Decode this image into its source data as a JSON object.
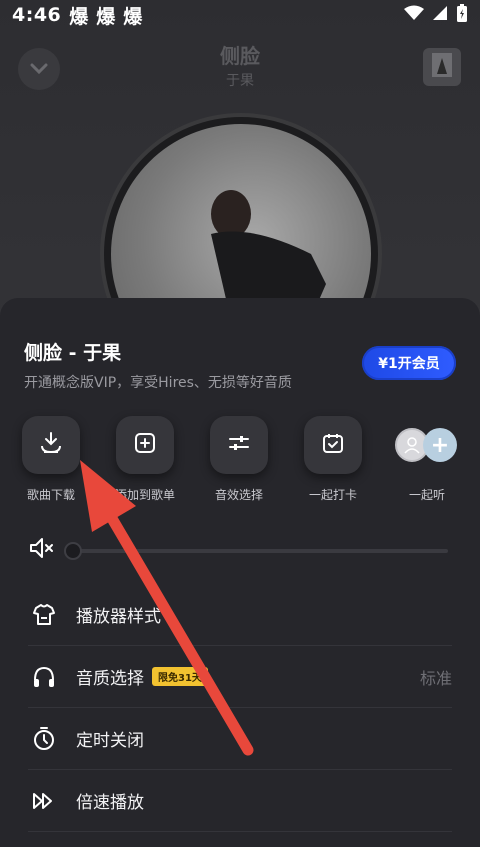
{
  "status_bar": {
    "time": "4:46",
    "notifications": [
      "爆",
      "爆",
      "爆"
    ]
  },
  "player": {
    "title": "侧脸",
    "artist": "于果"
  },
  "sheet": {
    "song_title": "侧脸 - 于果",
    "vip_promo": "开通概念版VIP，享受Hires、无损等好音质",
    "vip_button": "¥1开会员",
    "actions": [
      {
        "label": "歌曲下载",
        "icon": "download-icon"
      },
      {
        "label": "添加到歌单",
        "icon": "add-to-playlist-icon"
      },
      {
        "label": "音效选择",
        "icon": "sound-effect-icon"
      },
      {
        "label": "一起打卡",
        "icon": "check-in-icon"
      },
      {
        "label": "一起听",
        "icon": "listen-together-icon"
      }
    ],
    "volume": {
      "level": 0,
      "icon": "mute-icon"
    },
    "menu": [
      {
        "label": "播放器样式",
        "icon": "player-style-icon"
      },
      {
        "label": "音质选择",
        "icon": "headphones-icon",
        "badge": "限免31天",
        "value": "标准"
      },
      {
        "label": "定时关闭",
        "icon": "timer-icon"
      },
      {
        "label": "倍速播放",
        "icon": "speed-icon"
      }
    ]
  },
  "colors": {
    "sheet_bg": "#26262b",
    "vip_button": "#2f5cff",
    "badge": "#f2c230",
    "annotation_arrow": "#e8483b"
  }
}
